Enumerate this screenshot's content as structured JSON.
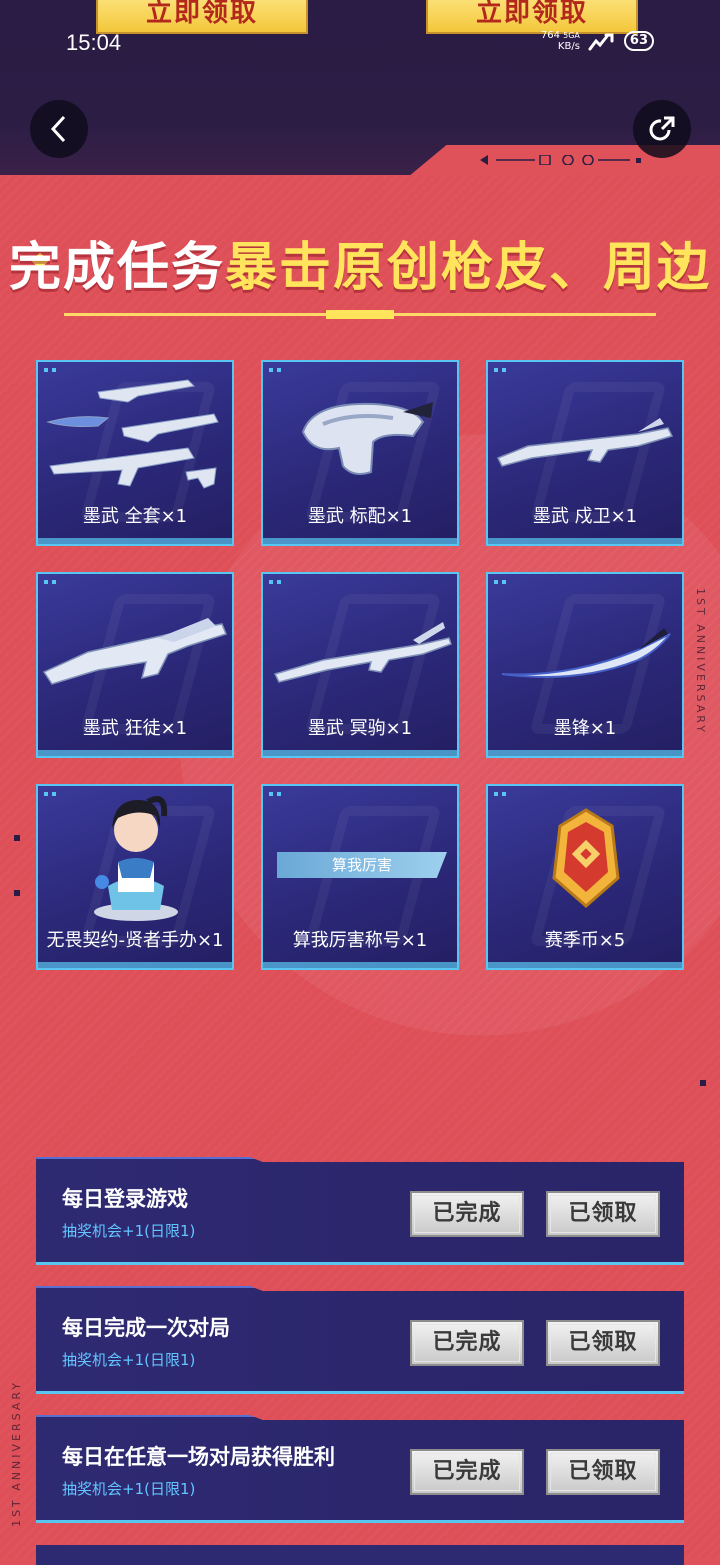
{
  "top_buttons": {
    "left": "立即领取",
    "right": "立即领取"
  },
  "status_bar": {
    "time": "15:04",
    "net_speed": "764",
    "net_unit": "KB/s",
    "network": "5GA",
    "battery": "63"
  },
  "nav": {
    "back_icon": "chevron-left-icon",
    "share_icon": "share-icon"
  },
  "title": {
    "part1": "完成任务",
    "part2": "暴击原创枪皮、周边"
  },
  "side_text": "1ST ANNIVERSARY",
  "rewards": [
    {
      "label": "墨武 全套×1",
      "icon": "weapon-set"
    },
    {
      "label": "墨武 标配×1",
      "icon": "pistol"
    },
    {
      "label": "墨武 戍卫×1",
      "icon": "rifle"
    },
    {
      "label": "墨武 狂徒×1",
      "icon": "assault-rifle"
    },
    {
      "label": "墨武 冥驹×1",
      "icon": "sniper"
    },
    {
      "label": "墨锋×1",
      "icon": "blade"
    },
    {
      "label": "无畏契约-贤者手办×1",
      "icon": "figure"
    },
    {
      "label": "算我厉害称号×1",
      "icon": "title-badge",
      "badge_text": "算我厉害"
    },
    {
      "label": "赛季币×5",
      "icon": "coin"
    }
  ],
  "tasks": [
    {
      "title": "每日登录游戏",
      "sub": "抽奖机会+1(日限1)",
      "done": "已完成",
      "claim": "已领取"
    },
    {
      "title": "每日完成一次对局",
      "sub": "抽奖机会+1(日限1)",
      "done": "已完成",
      "claim": "已领取"
    },
    {
      "title": "每日在任意一场对局获得胜利",
      "sub": "抽奖机会+1(日限1)",
      "done": "已完成",
      "claim": "已领取"
    }
  ],
  "colors": {
    "accent": "#58c6f0",
    "bg": "#de4f58",
    "title_yellow": "#ffe45c",
    "card": "#2a2776"
  }
}
